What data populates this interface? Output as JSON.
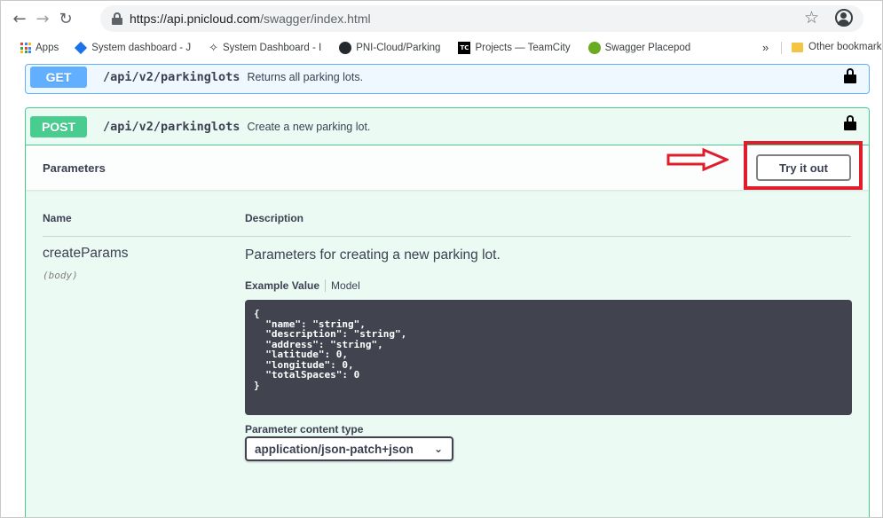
{
  "browser": {
    "url_host": "https://api.pnicloud.com",
    "url_path": "/swagger/index.html",
    "bookmarks": [
      {
        "label": "Apps",
        "icon": "apps-grid-icon"
      },
      {
        "label": "System dashboard - J",
        "icon": "jira-diamond-icon"
      },
      {
        "label": "System Dashboard - I",
        "icon": "satellite-icon"
      },
      {
        "label": "PNI-Cloud/Parking",
        "icon": "github-icon"
      },
      {
        "label": "Projects — TeamCity",
        "icon": "teamcity-icon"
      },
      {
        "label": "Swagger Placepod",
        "icon": "swagger-icon"
      }
    ],
    "more_bookmarks": "»",
    "other_bookmarks": "Other bookmarks"
  },
  "operations": {
    "get": {
      "method": "GET",
      "path": "/api/v2/parkinglots",
      "summary": "Returns all parking lots."
    },
    "post": {
      "method": "POST",
      "path": "/api/v2/parkinglots",
      "summary": "Create a new parking lot."
    }
  },
  "parameters": {
    "title": "Parameters",
    "try_button": "Try it out",
    "col_name": "Name",
    "col_description": "Description",
    "param_name": "createParams",
    "param_in": "(body)",
    "param_description": "Parameters for creating a new parking lot.",
    "tab_example": "Example Value",
    "tab_model": "Model",
    "example_json": "{\n  \"name\": \"string\",\n  \"description\": \"string\",\n  \"address\": \"string\",\n  \"latitude\": 0,\n  \"longitude\": 0,\n  \"totalSpaces\": 0\n}",
    "content_type_label": "Parameter content type",
    "content_type_value": "application/json-patch+json"
  },
  "colors": {
    "get": "#61affe",
    "post": "#49cc90",
    "highlight": "#e01e2b"
  }
}
